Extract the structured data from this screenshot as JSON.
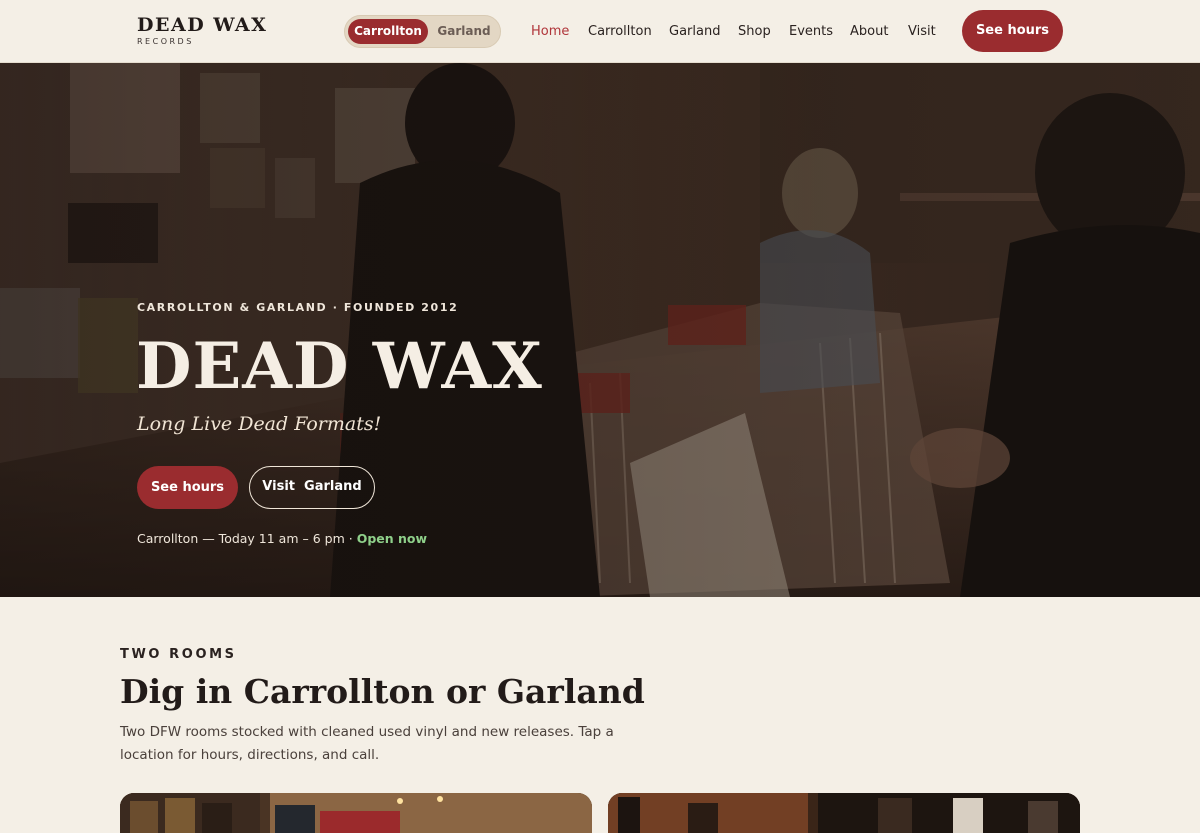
{
  "header": {
    "logo_main": "DEAD WAX",
    "logo_sub": "RECORDS",
    "location_toggle": {
      "active": "Carrollton",
      "inactive": "Garland"
    },
    "nav": [
      "Home",
      "Carrollton",
      "Garland",
      "Shop",
      "Events",
      "About",
      "Visit"
    ],
    "active_nav": "Home",
    "cta": "See hours"
  },
  "hero": {
    "kicker": "CARROLLTON & GARLAND · FOUNDED 2012",
    "title": "DEAD WAX",
    "tagline": "Long Live Dead Formats!",
    "btn_primary": "See hours",
    "btn_secondary": "Visit  Garland",
    "status_text": "Carrollton — Today 11 am – 6 pm ·",
    "status_open": "Open now"
  },
  "section": {
    "kicker": "TWO ROOMS",
    "title": "Dig in Carrollton or Garland",
    "description": "Two DFW rooms stocked with cleaned used vinyl and new releases. Tap a location for hours, directions, and call."
  },
  "colors": {
    "accent": "#9a2c2f",
    "background": "#f4efe6",
    "open_status": "#8fd08a"
  }
}
